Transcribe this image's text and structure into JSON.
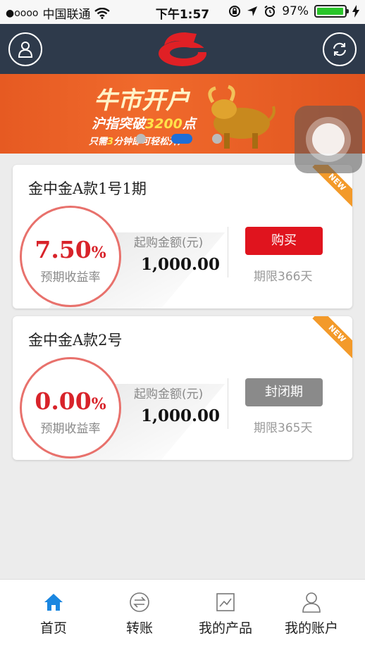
{
  "status_bar": {
    "signal": "●oooo",
    "carrier": "中国联通",
    "time": "下午1:57",
    "battery": "97%",
    "battery_level": 0.97
  },
  "header": {
    "left_icon": "user-icon",
    "right_icon": "refresh-icon",
    "logo_color": "#e02025"
  },
  "banner": {
    "title": "牛市开户",
    "sub_prefix": "沪指突破",
    "sub_highlight": "3200",
    "sub_suffix": "点",
    "small_prefix": "只需",
    "small_highlight": "3",
    "small_suffix": "分钟即可轻松开户",
    "pager_count": 3,
    "pager_active": 1
  },
  "products": [
    {
      "title": "金中金A款1号1期",
      "badge": "NEW",
      "rate": "7.50",
      "rate_unit": "%",
      "rate_label": "预期收益率",
      "min_label": "起购金额(元)",
      "min_value": "1,000.00",
      "action": "购买",
      "action_color": "#e0141e",
      "term": "期限366天"
    },
    {
      "title": "金中金A款2号",
      "badge": "NEW",
      "rate": "0.00",
      "rate_unit": "%",
      "rate_label": "预期收益率",
      "min_label": "起购金额(元)",
      "min_value": "1,000.00",
      "action": "封闭期",
      "action_color": "#8a8a8a",
      "term": "期限365天"
    }
  ],
  "tabbar": {
    "items": [
      {
        "label": "首页",
        "icon": "home-icon",
        "active": true
      },
      {
        "label": "转账",
        "icon": "transfer-icon",
        "active": false
      },
      {
        "label": "我的产品",
        "icon": "chart-icon",
        "active": false
      },
      {
        "label": "我的账户",
        "icon": "account-icon",
        "active": false
      }
    ]
  }
}
